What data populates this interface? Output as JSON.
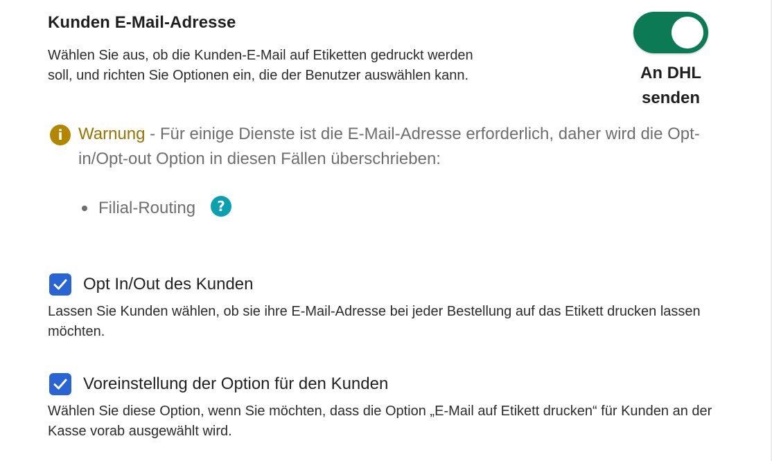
{
  "section": {
    "title": "Kunden E-Mail-Adresse",
    "description": "Wählen Sie aus, ob die Kunden-E-Mail auf Etiketten gedruckt werden soll, und richten Sie Optionen ein, die der Benutzer auswählen kann."
  },
  "toggle": {
    "state": "on",
    "label_line1": "An DHL",
    "label_line2": "senden",
    "color": "#0b7a55"
  },
  "warning": {
    "icon": "info-icon",
    "label": "Warnung",
    "text": " - Für einige Dienste ist die E-Mail-Adresse erforderlich, daher wird die Opt-in/Opt-out Option in diesen Fällen überschrieben:",
    "color": "#9a7200",
    "items": [
      {
        "label": "Filial-Routing",
        "help_icon": "question-circle-icon"
      }
    ]
  },
  "options": [
    {
      "checked": true,
      "label": "Opt In/Out des Kunden",
      "description": "Lassen Sie Kunden wählen, ob sie ihre E-Mail-Adresse bei jeder Bestellung auf das Etikett drucken lassen möchten."
    },
    {
      "checked": true,
      "label": "Voreinstellung der Option für den Kunden",
      "description": "Wählen Sie diese Option, wenn Sie möchten, dass die Option „E-Mail auf Etikett drucken“ für Kunden an der Kasse vorab ausgewählt wird."
    }
  ],
  "colors": {
    "checkbox": "#2a63d4",
    "help_icon": "#0aa0ad"
  }
}
